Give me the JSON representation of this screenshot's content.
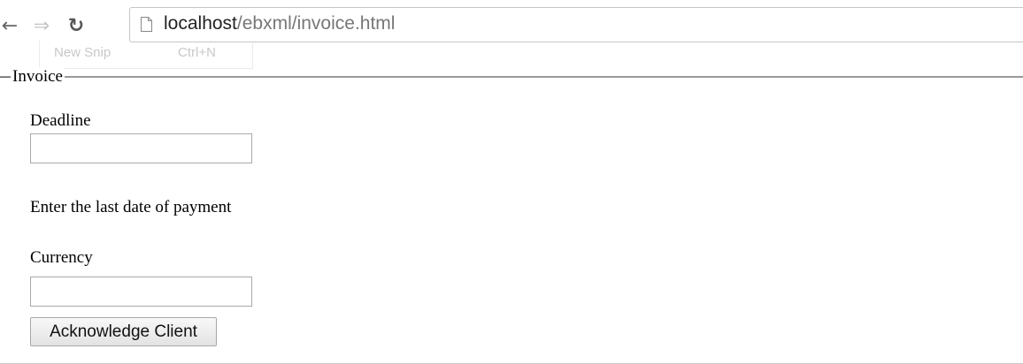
{
  "browser": {
    "url_host": "localhost",
    "url_path": "/ebxml/invoice.html",
    "snip_overlay": {
      "new_snip_label": "New Snip",
      "shortcut_label": "Ctrl+N"
    }
  },
  "form": {
    "legend": "Invoice",
    "deadline_label": "Deadline",
    "deadline_value": "",
    "deadline_hint": "Enter the last date of payment",
    "currency_label": "Currency",
    "currency_value": "",
    "submit_label": "Acknowledge Client"
  }
}
